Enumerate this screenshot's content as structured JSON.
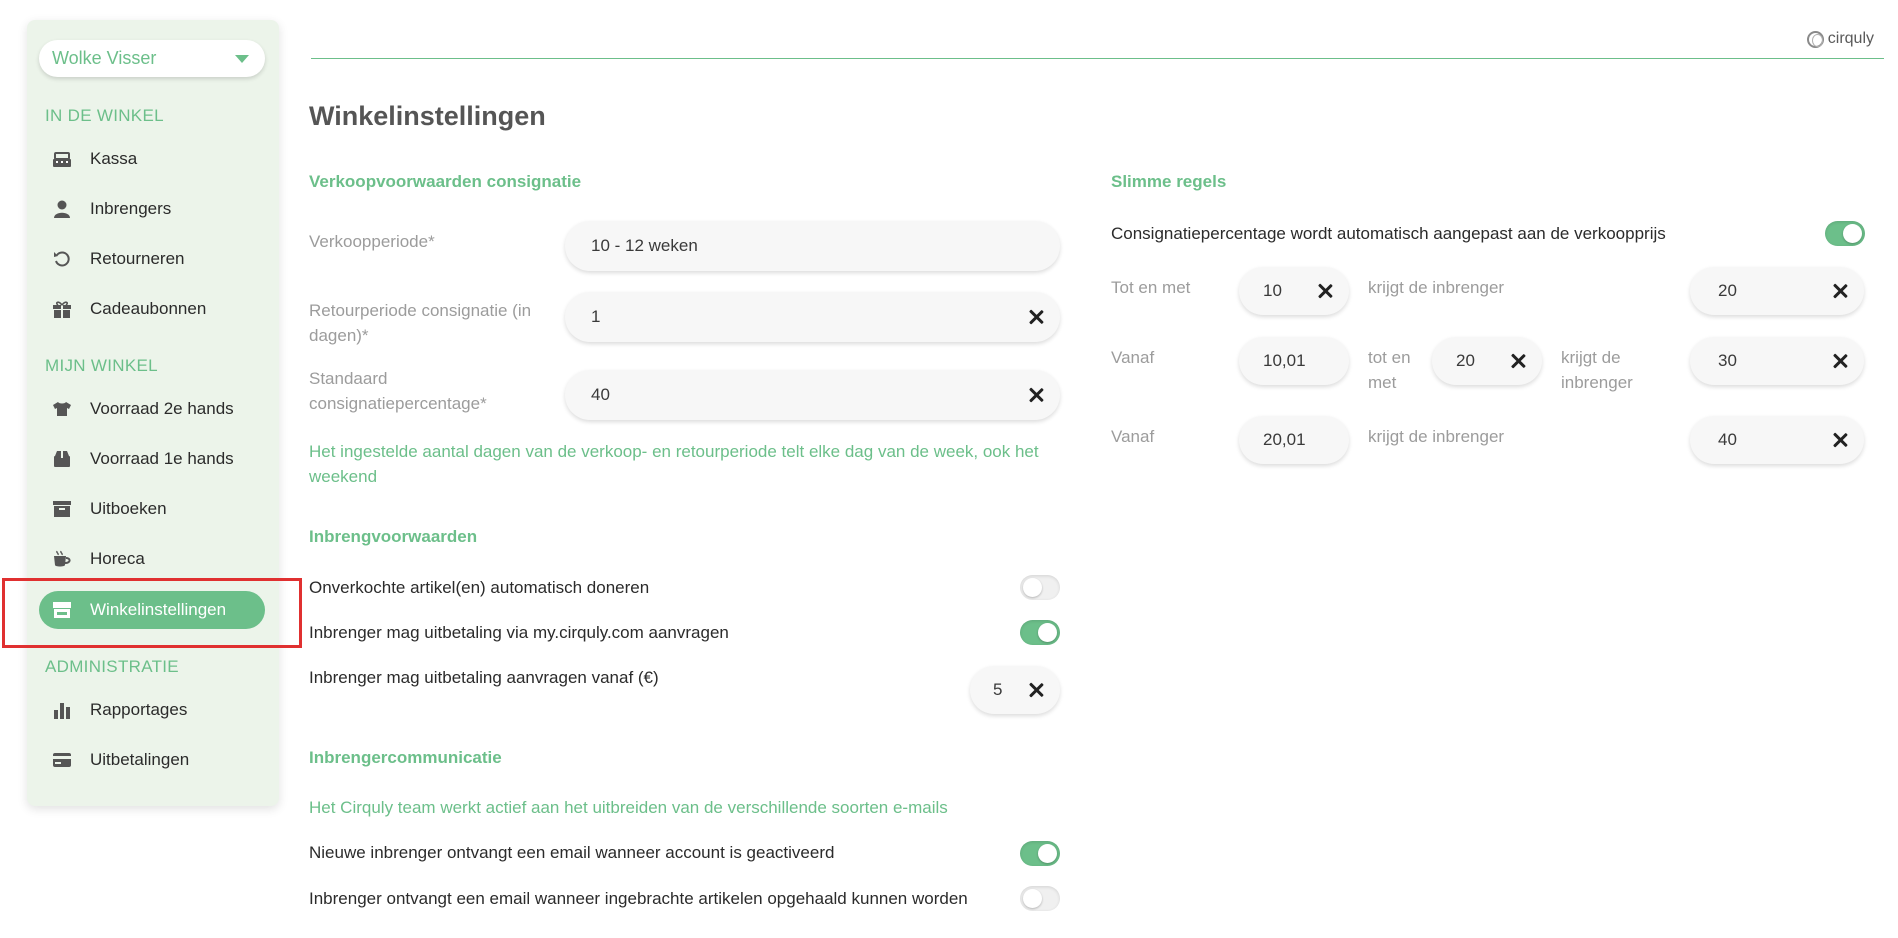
{
  "brand": {
    "name": "cirquly"
  },
  "sidebar": {
    "user": "Wolke Visser",
    "sections": {
      "in_de_winkel": "IN DE WINKEL",
      "mijn_winkel": "MIJN WINKEL",
      "administratie": "ADMINISTRATIE"
    },
    "items": [
      {
        "label": "Kassa",
        "icon": "cash-register-icon"
      },
      {
        "label": "Inbrengers",
        "icon": "person-icon"
      },
      {
        "label": "Retourneren",
        "icon": "return-icon"
      },
      {
        "label": "Cadeaubonnen",
        "icon": "gift-icon"
      },
      {
        "label": "Voorraad 2e hands",
        "icon": "shirt-icon"
      },
      {
        "label": "Voorraad 1e hands",
        "icon": "box-icon"
      },
      {
        "label": "Uitboeken",
        "icon": "archive-icon"
      },
      {
        "label": "Horeca",
        "icon": "coffee-icon"
      },
      {
        "label": "Winkelinstellingen",
        "icon": "store-icon",
        "active": true
      },
      {
        "label": "Rapportages",
        "icon": "bar-chart-icon"
      },
      {
        "label": "Uitbetalingen",
        "icon": "credit-card-icon"
      }
    ]
  },
  "page": {
    "title": "Winkelinstellingen"
  },
  "verkoop": {
    "title": "Verkoopvoorwaarden consignatie",
    "verkoopperiode_label": "Verkoopperiode*",
    "verkoopperiode_value": "10 - 12 weken",
    "retour_label_1": "Retourperiode consignatie (in",
    "retour_label_2": "dagen)*",
    "retour_value": "1",
    "standaard_label_1": "Standaard",
    "standaard_label_2": "consignatiepercentage*",
    "standaard_value": "40",
    "note_1": "Het ingestelde aantal dagen van de verkoop- en retourperiode telt elke dag van de week, ook het",
    "note_2": "weekend"
  },
  "inbreng": {
    "title": "Inbrengvoorwaarden",
    "doneren_label": "Onverkochte artikel(en) automatisch doneren",
    "doneren_on": false,
    "uitbetaling_label": "Inbrenger mag uitbetaling via my.cirquly.com aanvragen",
    "uitbetaling_on": true,
    "vanaf_label": "Inbrenger mag uitbetaling aanvragen vanaf (€)",
    "vanaf_value": "5"
  },
  "communicatie": {
    "title": "Inbrengercommunicatie",
    "note": "Het Cirquly team werkt actief aan het uitbreiden van de verschillende soorten e-mails",
    "email_activated_label": "Nieuwe inbrenger ontvangt een email wanneer account is geactiveerd",
    "email_activated_on": true,
    "email_pickup_label": "Inbrenger ontvangt een email wanneer ingebrachte artikelen opgehaald kunnen worden",
    "email_pickup_on": false
  },
  "slimme": {
    "title": "Slimme regels",
    "auto_label": "Consignatiepercentage wordt automatisch aangepast aan de verkoopprijs",
    "auto_on": true,
    "row1": {
      "label": "Tot en met",
      "threshold": "10",
      "mid_label": "krijgt de inbrenger",
      "percent": "20"
    },
    "row2": {
      "label": "Vanaf",
      "from": "10,01",
      "tot_label_1": "tot en",
      "tot_label_2": "met",
      "to": "20",
      "mid_label_1": "krijgt de",
      "mid_label_2": "inbrenger",
      "percent": "30"
    },
    "row3": {
      "label": "Vanaf",
      "from": "20,01",
      "mid_label": "krijgt de inbrenger",
      "percent": "40"
    }
  },
  "colors": {
    "accent": "#6cbf8a",
    "sidebar_bg": "#ecf4ea",
    "highlight": "#e03030"
  }
}
